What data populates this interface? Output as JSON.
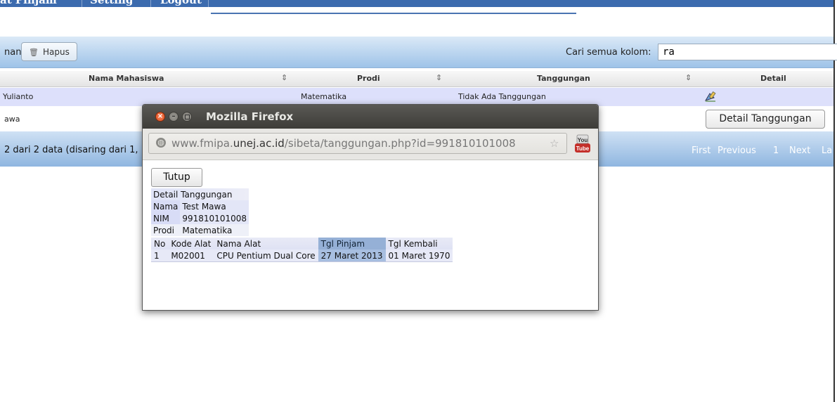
{
  "nav": {
    "items": [
      "at Pinjam",
      "Setting",
      "Logout"
    ]
  },
  "toolbar": {
    "partial_label": "nan",
    "hapus_label": "Hapus",
    "search_label": "Cari semua kolom:",
    "search_value": "ra"
  },
  "table": {
    "columns": [
      "Nama Mahasiswa",
      "Prodi",
      "Tanggungan",
      "Detail"
    ],
    "rows": [
      {
        "nama": "Yulianto",
        "prodi": "Matematika",
        "tanggungan": "Tidak Ada Tanggungan"
      },
      {
        "nama": "awa",
        "prodi": "",
        "tanggungan": "",
        "detail_button": "Detail Tanggungan"
      }
    ],
    "footer_info": "2 dari 2 data (disaring dari 1,",
    "pager": [
      "First",
      "Previous",
      "1",
      "Next",
      "La"
    ]
  },
  "popup": {
    "title": "Mozilla Firefox",
    "url_prefix": "www.fmipa.",
    "url_domain": "unej.ac.id",
    "url_path": "/sibeta/tanggungan.php?id=991810101008",
    "close_button": "Tutup",
    "detail_title": "Detail Tanggungan",
    "fields": [
      {
        "label": "Nama",
        "value": "Test Mawa"
      },
      {
        "label": "NIM",
        "value": "991810101008"
      },
      {
        "label": "Prodi",
        "value": "Matematika"
      }
    ],
    "item_headers": [
      "No",
      "Kode Alat",
      "Nama Alat",
      "Tgl Pinjam",
      "Tgl Kembali"
    ],
    "items": [
      [
        "1",
        "M02001",
        "CPU Pentium Dual Core",
        "27 Maret 2013",
        "01 Maret 1970"
      ]
    ]
  },
  "colors": {
    "nav": "#3c6bae",
    "row_highlight": "#dde0fb",
    "titlebar": "#4a4945",
    "close_button": "#e2521d"
  }
}
